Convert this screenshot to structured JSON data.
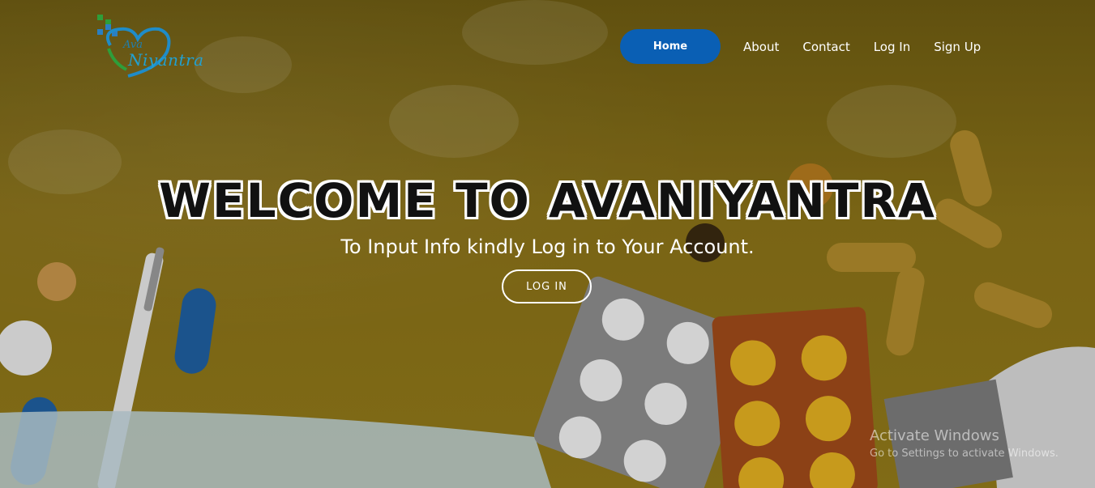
{
  "brand": {
    "logo_small_text": "Ava",
    "logo_large_text": "Niyantra"
  },
  "nav": {
    "items": [
      {
        "label": "Home",
        "active": true
      },
      {
        "label": "About"
      },
      {
        "label": "Contact"
      },
      {
        "label": "Log In"
      },
      {
        "label": "Sign Up"
      }
    ]
  },
  "hero": {
    "title": "WELCOME TO AVANIYANTRA",
    "subtitle": "To Input Info kindly Log in to Your Account.",
    "cta_label": "LOG IN"
  },
  "watermark": {
    "title": "Activate Windows",
    "subtitle": "Go to Settings to activate Windows."
  },
  "colors": {
    "accent": "#0a5fb4",
    "background": "#8a7218"
  }
}
